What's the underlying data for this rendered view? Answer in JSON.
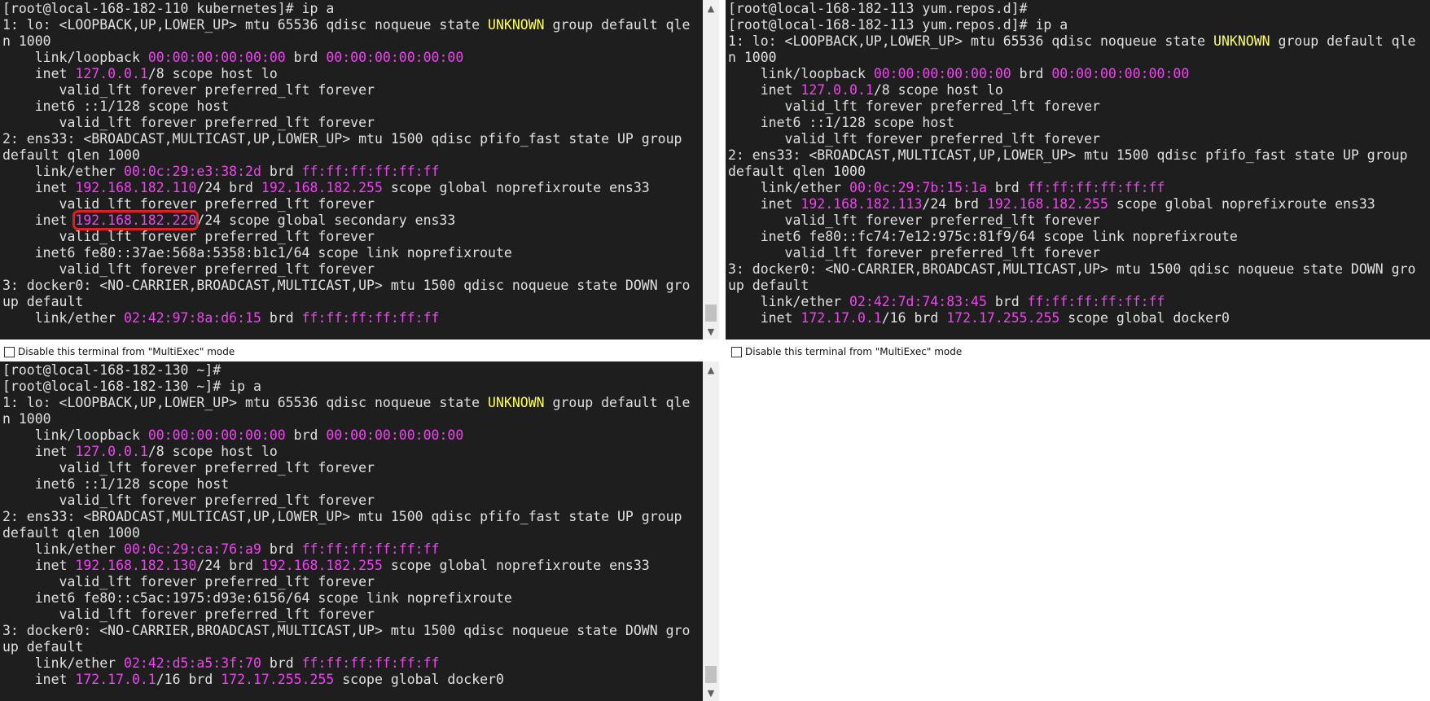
{
  "terminals": [
    {
      "id": "t1",
      "lines": [
        [
          [
            "[root@local-168-182-110 kubernetes]# ip a",
            ""
          ]
        ],
        [
          [
            "1: lo: <LOOPBACK,UP,LOWER_UP> mtu 65536 qdisc noqueue state ",
            ""
          ],
          [
            "UNKNOWN",
            "y"
          ],
          [
            " group default qle",
            ""
          ]
        ],
        [
          [
            "n 1000",
            ""
          ]
        ],
        [
          [
            "    link/loopback ",
            ""
          ],
          [
            "00:00:00:00:00:00",
            "m"
          ],
          [
            " brd ",
            ""
          ],
          [
            "00:00:00:00:00:00",
            "m"
          ]
        ],
        [
          [
            "    inet ",
            ""
          ],
          [
            "127.0.0.1",
            "m"
          ],
          [
            "/8 scope host lo",
            ""
          ]
        ],
        [
          [
            "       valid_lft forever preferred_lft forever",
            ""
          ]
        ],
        [
          [
            "    inet6 ::1/128 scope host",
            ""
          ]
        ],
        [
          [
            "       valid_lft forever preferred_lft forever",
            ""
          ]
        ],
        [
          [
            "2: ens33: <BROADCAST,MULTICAST,UP,LOWER_UP> mtu 1500 qdisc pfifo_fast state UP group",
            ""
          ]
        ],
        [
          [
            "default qlen 1000",
            ""
          ]
        ],
        [
          [
            "    link/ether ",
            ""
          ],
          [
            "00:0c:29:e3:38:2d",
            "m"
          ],
          [
            " brd ",
            ""
          ],
          [
            "ff:ff:ff:ff:ff:ff",
            "m"
          ]
        ],
        [
          [
            "    inet ",
            ""
          ],
          [
            "192.168.182.110",
            "m"
          ],
          [
            "/24 brd ",
            ""
          ],
          [
            "192.168.182.255",
            "m"
          ],
          [
            " scope global noprefixroute ens33",
            ""
          ]
        ],
        [
          [
            "       valid_lft forever preferred_lft forever",
            ""
          ]
        ],
        [
          [
            "    inet ",
            ""
          ],
          [
            "192.168.182.220",
            "m hl"
          ],
          [
            "/24 scope global secondary ens33",
            ""
          ]
        ],
        [
          [
            "       valid_lft forever preferred_lft forever",
            ""
          ]
        ],
        [
          [
            "    inet6 fe80::37ae:568a:5358:b1c1/64 scope link noprefixroute",
            ""
          ]
        ],
        [
          [
            "       valid_lft forever preferred_lft forever",
            ""
          ]
        ],
        [
          [
            "3: docker0: <NO-CARRIER,BROADCAST,MULTICAST,UP> mtu 1500 qdisc noqueue state DOWN gro",
            ""
          ]
        ],
        [
          [
            "up default",
            ""
          ]
        ],
        [
          [
            "    link/ether ",
            ""
          ],
          [
            "02:42:97:8a:d6:15",
            "m"
          ],
          [
            " brd ",
            ""
          ],
          [
            "ff:ff:ff:ff:ff:ff",
            "m"
          ]
        ]
      ]
    },
    {
      "id": "t2",
      "lines": [
        [
          [
            "[root@local-168-182-113 yum.repos.d]#",
            ""
          ]
        ],
        [
          [
            "[root@local-168-182-113 yum.repos.d]# ip a",
            ""
          ]
        ],
        [
          [
            "1: lo: <LOOPBACK,UP,LOWER_UP> mtu 65536 qdisc noqueue state ",
            ""
          ],
          [
            "UNKNOWN",
            "y"
          ],
          [
            " group default qle",
            ""
          ]
        ],
        [
          [
            "n 1000",
            ""
          ]
        ],
        [
          [
            "    link/loopback ",
            ""
          ],
          [
            "00:00:00:00:00:00",
            "m"
          ],
          [
            " brd ",
            ""
          ],
          [
            "00:00:00:00:00:00",
            "m"
          ]
        ],
        [
          [
            "    inet ",
            ""
          ],
          [
            "127.0.0.1",
            "m"
          ],
          [
            "/8 scope host lo",
            ""
          ]
        ],
        [
          [
            "       valid_lft forever preferred_lft forever",
            ""
          ]
        ],
        [
          [
            "    inet6 ::1/128 scope host",
            ""
          ]
        ],
        [
          [
            "       valid_lft forever preferred_lft forever",
            ""
          ]
        ],
        [
          [
            "2: ens33: <BROADCAST,MULTICAST,UP,LOWER_UP> mtu 1500 qdisc pfifo_fast state UP group",
            ""
          ]
        ],
        [
          [
            "default qlen 1000",
            ""
          ]
        ],
        [
          [
            "    link/ether ",
            ""
          ],
          [
            "00:0c:29:7b:15:1a",
            "m"
          ],
          [
            " brd ",
            ""
          ],
          [
            "ff:ff:ff:ff:ff:ff",
            "m"
          ]
        ],
        [
          [
            "    inet ",
            ""
          ],
          [
            "192.168.182.113",
            "m"
          ],
          [
            "/24 brd ",
            ""
          ],
          [
            "192.168.182.255",
            "m"
          ],
          [
            " scope global noprefixroute ens33",
            ""
          ]
        ],
        [
          [
            "       valid_lft forever preferred_lft forever",
            ""
          ]
        ],
        [
          [
            "    inet6 fe80::fc74:7e12:975c:81f9/64 scope link noprefixroute",
            ""
          ]
        ],
        [
          [
            "       valid_lft forever preferred_lft forever",
            ""
          ]
        ],
        [
          [
            "3: docker0: <NO-CARRIER,BROADCAST,MULTICAST,UP> mtu 1500 qdisc noqueue state DOWN gro",
            ""
          ]
        ],
        [
          [
            "up default",
            ""
          ]
        ],
        [
          [
            "    link/ether ",
            ""
          ],
          [
            "02:42:7d:74:83:45",
            "m"
          ],
          [
            " brd ",
            ""
          ],
          [
            "ff:ff:ff:ff:ff:ff",
            "m"
          ]
        ],
        [
          [
            "    inet ",
            ""
          ],
          [
            "172.17.0.1",
            "m"
          ],
          [
            "/16 brd ",
            ""
          ],
          [
            "172.17.255.255",
            "m"
          ],
          [
            " scope global docker0",
            ""
          ]
        ]
      ]
    },
    {
      "id": "t3",
      "lines": [
        [
          [
            "[root@local-168-182-130 ~]#",
            ""
          ]
        ],
        [
          [
            "[root@local-168-182-130 ~]# ip a",
            ""
          ]
        ],
        [
          [
            "1: lo: <LOOPBACK,UP,LOWER_UP> mtu 65536 qdisc noqueue state ",
            ""
          ],
          [
            "UNKNOWN",
            "y"
          ],
          [
            " group default qle",
            ""
          ]
        ],
        [
          [
            "n 1000",
            ""
          ]
        ],
        [
          [
            "    link/loopback ",
            ""
          ],
          [
            "00:00:00:00:00:00",
            "m"
          ],
          [
            " brd ",
            ""
          ],
          [
            "00:00:00:00:00:00",
            "m"
          ]
        ],
        [
          [
            "    inet ",
            ""
          ],
          [
            "127.0.0.1",
            "m"
          ],
          [
            "/8 scope host lo",
            ""
          ]
        ],
        [
          [
            "       valid_lft forever preferred_lft forever",
            ""
          ]
        ],
        [
          [
            "    inet6 ::1/128 scope host",
            ""
          ]
        ],
        [
          [
            "       valid_lft forever preferred_lft forever",
            ""
          ]
        ],
        [
          [
            "2: ens33: <BROADCAST,MULTICAST,UP,LOWER_UP> mtu 1500 qdisc pfifo_fast state UP group",
            ""
          ]
        ],
        [
          [
            "default qlen 1000",
            ""
          ]
        ],
        [
          [
            "    link/ether ",
            ""
          ],
          [
            "00:0c:29:ca:76:a9",
            "m"
          ],
          [
            " brd ",
            ""
          ],
          [
            "ff:ff:ff:ff:ff:ff",
            "m"
          ]
        ],
        [
          [
            "    inet ",
            ""
          ],
          [
            "192.168.182.130",
            "m"
          ],
          [
            "/24 brd ",
            ""
          ],
          [
            "192.168.182.255",
            "m"
          ],
          [
            " scope global noprefixroute ens33",
            ""
          ]
        ],
        [
          [
            "       valid_lft forever preferred_lft forever",
            ""
          ]
        ],
        [
          [
            "    inet6 fe80::c5ac:1975:d93e:6156/64 scope link noprefixroute",
            ""
          ]
        ],
        [
          [
            "       valid_lft forever preferred_lft forever",
            ""
          ]
        ],
        [
          [
            "3: docker0: <NO-CARRIER,BROADCAST,MULTICAST,UP> mtu 1500 qdisc noqueue state DOWN gro",
            ""
          ]
        ],
        [
          [
            "up default",
            ""
          ]
        ],
        [
          [
            "    link/ether ",
            ""
          ],
          [
            "02:42:d5:a5:3f:70",
            "m"
          ],
          [
            " brd ",
            ""
          ],
          [
            "ff:ff:ff:ff:ff:ff",
            "m"
          ]
        ],
        [
          [
            "    inet ",
            ""
          ],
          [
            "172.17.0.1",
            "m"
          ],
          [
            "/16 brd ",
            ""
          ],
          [
            "172.17.255.255",
            "m"
          ],
          [
            " scope global docker0",
            ""
          ]
        ]
      ]
    }
  ],
  "multiexec": {
    "label": "Disable this terminal from \"MultiExec\" mode"
  },
  "scroll_icons": {
    "up": "scroll-up-arrow",
    "down": "scroll-down-arrow"
  },
  "colors": {
    "terminal_bg": "#1e1e1e",
    "text": "#e0e0e0",
    "keyword_yellow": "#ffff55",
    "address_magenta": "#ee44ee",
    "highlight_box": "#e02020"
  }
}
